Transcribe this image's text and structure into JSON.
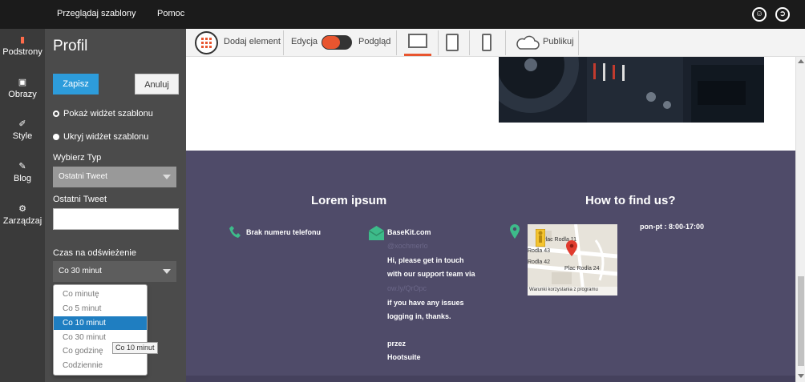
{
  "topbar": {
    "nav": [
      "Przeglądaj szablony",
      "Pomoc"
    ],
    "icons": [
      "account-icon",
      "logout-icon"
    ]
  },
  "leftnav": {
    "items": [
      {
        "label": "Podstrony",
        "icon": "page-icon"
      },
      {
        "label": "Obrazy",
        "icon": "image-icon"
      },
      {
        "label": "Style",
        "icon": "brush-icon"
      },
      {
        "label": "Blog",
        "icon": "edit-icon"
      },
      {
        "label": "Zarządzaj",
        "icon": "gear-icon"
      }
    ]
  },
  "panel": {
    "title": "Profil",
    "save_label": "Zapisz",
    "cancel_label": "Anuluj",
    "radio_show": "Pokaż widżet szablonu",
    "radio_hide": "Ukryj widżet szablonu",
    "type_label": "Wybierz Typ",
    "type_value": "Ostatni Tweet",
    "tweet_label": "Ostatni Tweet",
    "tweet_value": "",
    "refresh_label": "Czas na odświeżenie",
    "refresh_value": "Co 30 minut",
    "refresh_options": [
      "Co minutę",
      "Co 5 minut",
      "Co 10 minut",
      "Co 30 minut",
      "Co godzinę",
      "Codziennie"
    ],
    "highlighted_option": "Co 10 minut",
    "tooltip": "Co 10 minut"
  },
  "toolbar": {
    "add_element": "Dodaj element",
    "edit": "Edycja",
    "preview": "Podgląd",
    "publish": "Publikuj",
    "devices": [
      "desktop-icon",
      "tablet-icon",
      "phone-icon"
    ]
  },
  "footer": {
    "col1_heading": "Lorem ipsum",
    "col2_heading": "How to find us?",
    "phone_text": "Brak numeru telefonu",
    "email_title": "BaseKit.com",
    "email_handle": "@xochmerlo",
    "email_lines": [
      "Hi, please get in touch",
      "with our support team via",
      "ow.ly/QrOpc",
      "if you have any issues",
      "logging in, thanks.",
      "",
      "przez",
      "Hootsuite"
    ],
    "hours": "pon-pt : 8:00-17:00",
    "map": {
      "labels": [
        "Plac Rodla 11",
        "Rodla 43",
        "Rodla 42",
        "Plac Rodla 24",
        "Warunki korzystania z programu"
      ]
    }
  },
  "colors": {
    "accent": "#e8552f",
    "save_blue": "#2d9cdb",
    "footer_bg": "#4f4b69",
    "selection_blue": "#1f7ec1"
  }
}
